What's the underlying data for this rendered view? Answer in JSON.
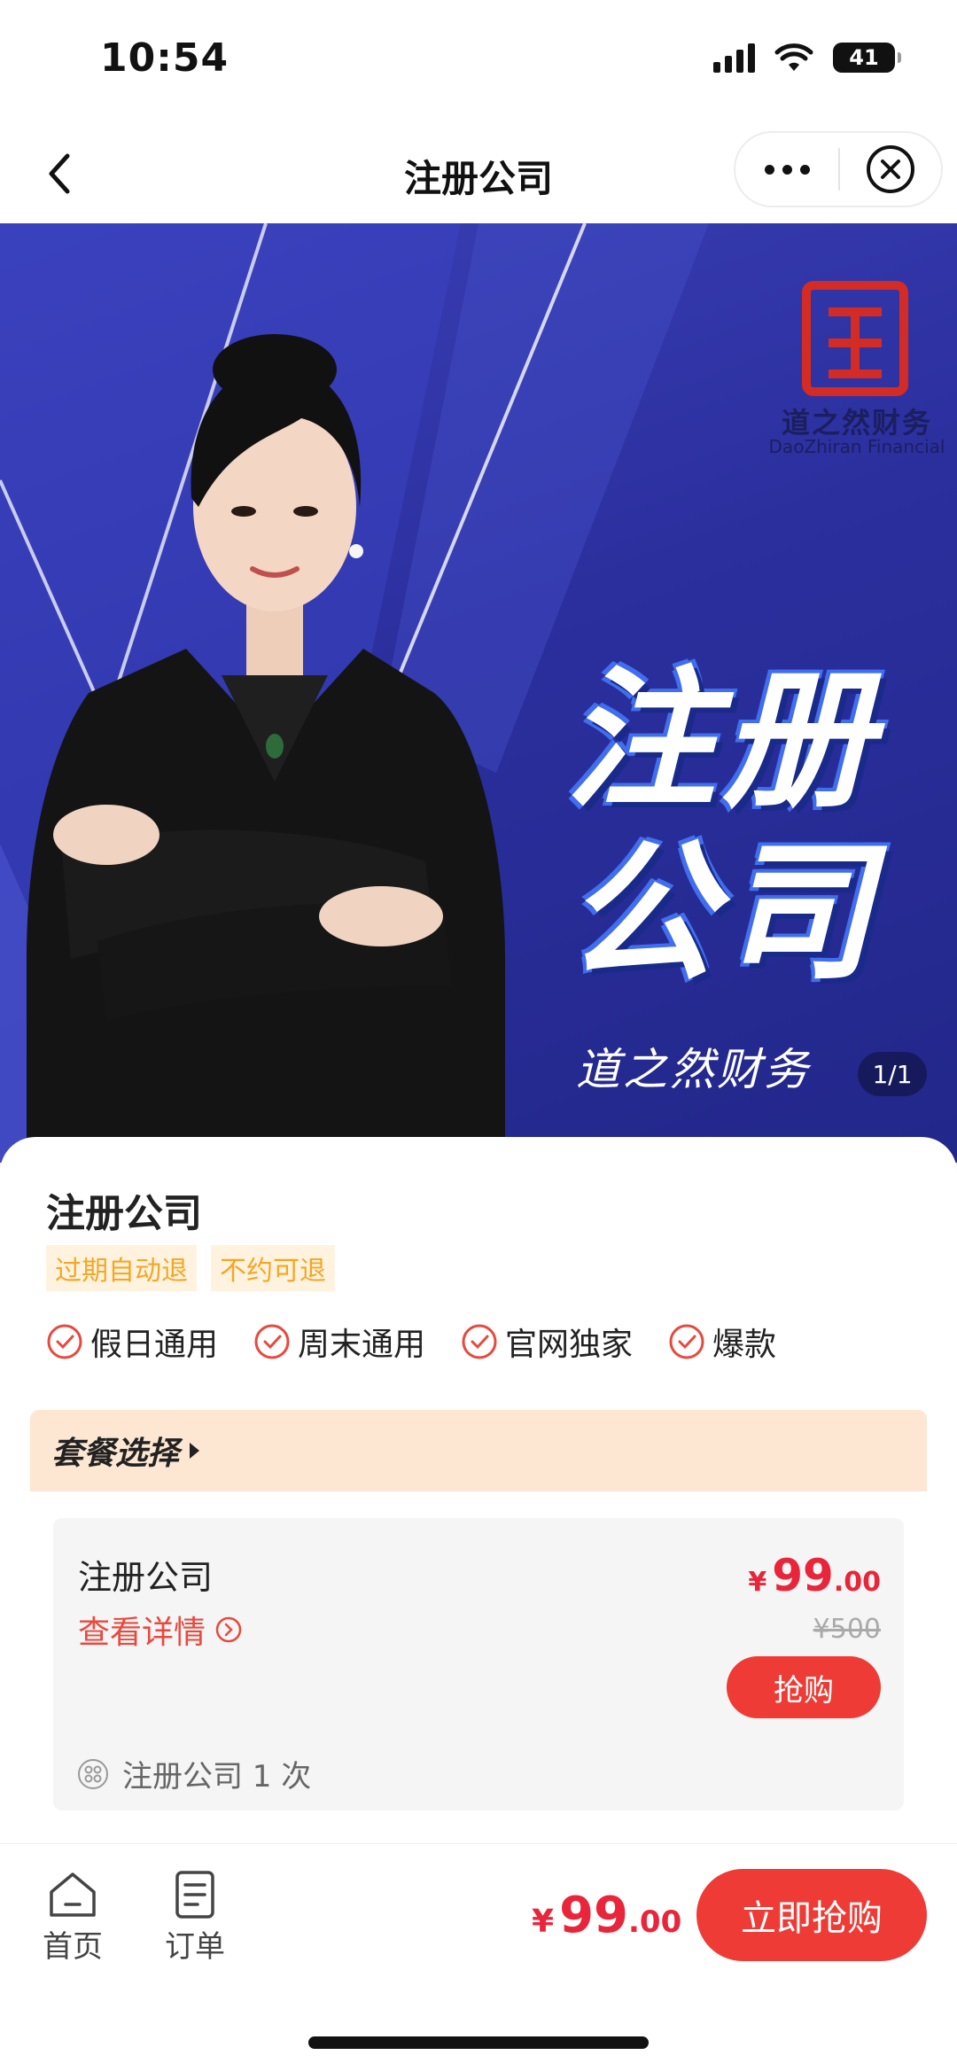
{
  "status_bar": {
    "time": "10:54",
    "battery": "41"
  },
  "nav": {
    "title": "注册公司"
  },
  "banner": {
    "brand_logo_text": "道之然财务",
    "brand_logo_en": "DaoZhiran Financial",
    "headline_line1": "注册",
    "headline_line2": "公司",
    "signature": "道之然财务",
    "page_counter": "1/1"
  },
  "product": {
    "title": "注册公司",
    "tags": [
      "过期自动退",
      "不约可退"
    ],
    "features": [
      "假日通用",
      "周末通用",
      "官网独家",
      "爆款"
    ]
  },
  "package": {
    "header": "套餐选择",
    "item": {
      "name": "注册公司",
      "detail_link": "查看详情",
      "price_symbol": "¥",
      "price_int": "99",
      "price_dec": ".00",
      "original_price": "¥500",
      "buy_label": "抢购",
      "contents": "注册公司 1 次"
    }
  },
  "bottom_bar": {
    "home_label": "首页",
    "orders_label": "订单",
    "price_symbol": "¥",
    "price_int": "99",
    "price_dec": ".00",
    "buy_now_label": "立即抢购"
  },
  "colors": {
    "accent_red": "#ee3b35",
    "price_red": "#e8253a",
    "banner_blue": "#2b2f9e",
    "tag_orange": "#f5a623"
  }
}
